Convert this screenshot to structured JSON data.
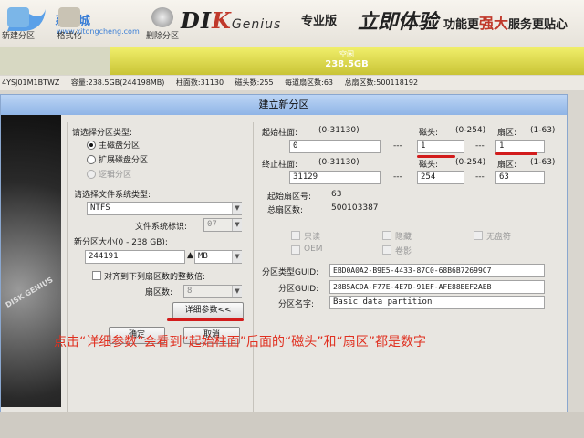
{
  "app": {
    "watermark_title": "系统城",
    "watermark_url": "www.xitongcheng.com",
    "toolbar": [
      {
        "label": "新建分区",
        "icon": "new-partition-icon"
      },
      {
        "label": "格式化",
        "icon": "format-icon"
      },
      {
        "label": "删除分区",
        "icon": "delete-partition-icon"
      }
    ],
    "brand_prefix": "DI",
    "brand_k": "K",
    "brand_suffix": "Genius",
    "brand_edition": "专业版",
    "slogan": "立即体验",
    "tag_prefix": "功能更",
    "tag_strong": "强大",
    "tag_suffix": "服务更贴心"
  },
  "disk": {
    "free_label": "空闲",
    "free_size": "238.5GB",
    "model": "4YSJ01M1BTWZ",
    "capacity": "容量:238.5GB(244198MB)",
    "cylinders": "柱面数:31130",
    "heads": "磁头数:255",
    "sectors_per_track": "每道扇区数:63",
    "total_sectors": "总扇区数:500118192"
  },
  "dialog": {
    "title": "建立新分区",
    "partition_type_label": "请选择分区类型:",
    "partition_types": [
      "主磁盘分区",
      "扩展磁盘分区",
      "逻辑分区"
    ],
    "fs_type_label": "请选择文件系统类型:",
    "fs_type_value": "NTFS",
    "fs_id_label": "文件系统标识:",
    "fs_id_value": "07",
    "size_label": "新分区大小(0 - 238 GB):",
    "size_value": "244191",
    "size_unit": "MB",
    "align_label": "对齐到下列扇区数的整数倍:",
    "sector_count_label": "扇区数:",
    "sector_count_value": "8",
    "start_cyl_label": "起始柱面:",
    "start_cyl_range": "(0-31130)",
    "start_cyl_value": "0",
    "head_label": "磁头:",
    "head_range": "(0-254)",
    "start_head_value": "1",
    "sector_label": "扇区:",
    "sector_range": "(1-63)",
    "start_sector_value": "1",
    "end_cyl_label": "终止柱面:",
    "end_cyl_range": "(0-31130)",
    "end_cyl_value": "31129",
    "end_head_value": "254",
    "end_sector_value": "63",
    "start_lba_label": "起始扇区号:",
    "start_lba_value": "63",
    "total_sectors_label": "总扇区数:",
    "total_sectors_value": "500103387",
    "dash": "---",
    "flags": [
      "只读",
      "隐藏",
      "无盘符",
      "OEM",
      "卷影"
    ],
    "type_guid_label": "分区类型GUID:",
    "type_guid_value": "EBD0A0A2-B9E5-4433-87C0-68B6B72699C7",
    "part_guid_label": "分区GUID:",
    "part_guid_value": "28B5ACDA-F77E-4E7D-91EF-AFE88BEF2AEB",
    "part_name_label": "分区名字:",
    "part_name_value": "Basic data partition",
    "details_button": "详细参数<<",
    "ok_button": "确定",
    "cancel_button": "取消"
  },
  "annotation": "点击“详细参数”会看到“起始柱面”后面的“磁头”和“扇区”都是数字",
  "colors": {
    "accent_red": "#d21c1c",
    "free_space": "#d8d450",
    "title_bar": "#a6c6ee"
  }
}
